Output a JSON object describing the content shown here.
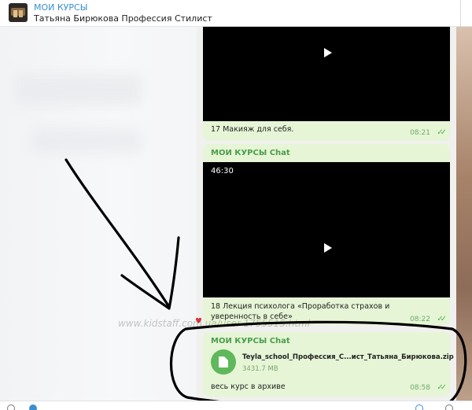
{
  "header": {
    "title": "МОИ КУРСЫ",
    "subtitle": "Татьяна Бирюкова Профессия Стилист",
    "avatar_icon": "channel-avatar"
  },
  "messages": [
    {
      "type": "video",
      "caption": "17 Макияж для себя.",
      "time": "08:21",
      "status_icon": "double-check-icon"
    },
    {
      "type": "video",
      "sender": "МОИ КУРСЫ Chat",
      "duration": "46:30",
      "caption": "18 Лекция психолога «Проработка страхов и уверенность в себе»",
      "time": "08:22",
      "status_icon": "double-check-icon"
    },
    {
      "type": "file",
      "sender": "МОИ КУРСЫ Chat",
      "file_name": "Teyla_school_Профессия_С...ист_Татьяна_Бирюкова.zip",
      "file_size": "3431.7 MB",
      "description": "весь курс в архиве",
      "time": "08:58",
      "status_icon": "double-check-icon"
    }
  ],
  "watermark": "www.kidstaff.com.ua/user-1755515.html",
  "colors": {
    "accent": "#3a8fd0",
    "bubble": "#e6f5d6",
    "sender": "#4a9e4a",
    "file_icon": "#5fb85b",
    "annotation": "#000000"
  }
}
